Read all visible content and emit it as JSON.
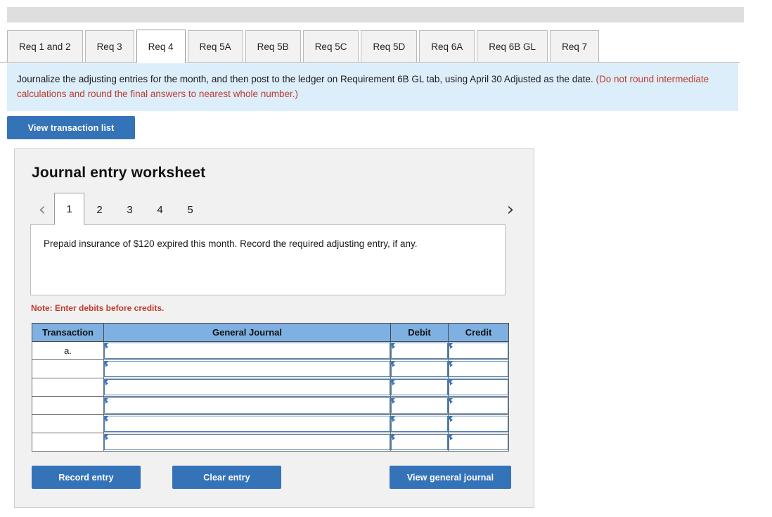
{
  "tabs": [
    {
      "label": "Req 1 and 2",
      "active": false
    },
    {
      "label": "Req 3",
      "active": false
    },
    {
      "label": "Req 4",
      "active": true
    },
    {
      "label": "Req 5A",
      "active": false
    },
    {
      "label": "Req 5B",
      "active": false
    },
    {
      "label": "Req 5C",
      "active": false
    },
    {
      "label": "Req 5D",
      "active": false
    },
    {
      "label": "Req 6A",
      "active": false
    },
    {
      "label": "Req 6B GL",
      "active": false
    },
    {
      "label": "Req 7",
      "active": false
    }
  ],
  "instruction": {
    "main": "Journalize the adjusting entries for the month, and then post to the ledger on Requirement 6B GL tab, using April 30 Adjusted as the date. ",
    "parenthetical": "(Do not round intermediate calculations and round the final answers to nearest whole number.)"
  },
  "toolbar": {
    "view_transaction_list_label": "View transaction list"
  },
  "worksheet": {
    "title": "Journal entry worksheet",
    "pager": {
      "prev_icon": "‹",
      "next_icon": "›",
      "pages": [
        "1",
        "2",
        "3",
        "4",
        "5"
      ],
      "active_page": "1"
    },
    "question": "Prepaid insurance of $120 expired this month. Record the required adjusting entry, if any.",
    "note": "Note: Enter debits before credits.",
    "table": {
      "headers": [
        "Transaction",
        "General Journal",
        "Debit",
        "Credit"
      ],
      "rows": [
        {
          "transaction": "a.",
          "general_journal": "",
          "debit": "",
          "credit": ""
        },
        {
          "transaction": "",
          "general_journal": "",
          "debit": "",
          "credit": ""
        },
        {
          "transaction": "",
          "general_journal": "",
          "debit": "",
          "credit": ""
        },
        {
          "transaction": "",
          "general_journal": "",
          "debit": "",
          "credit": ""
        },
        {
          "transaction": "",
          "general_journal": "",
          "debit": "",
          "credit": ""
        },
        {
          "transaction": "",
          "general_journal": "",
          "debit": "",
          "credit": ""
        }
      ]
    },
    "buttons": {
      "record_entry": "Record entry",
      "clear_entry": "Clear entry",
      "view_general_journal": "View general journal"
    }
  },
  "colors": {
    "accent_blue": "#3573b9",
    "table_header_blue": "#7eb0e2",
    "banner_blue": "#ddeefb",
    "alert_red": "#c0392b",
    "panel_gray": "#f1f1f1"
  }
}
